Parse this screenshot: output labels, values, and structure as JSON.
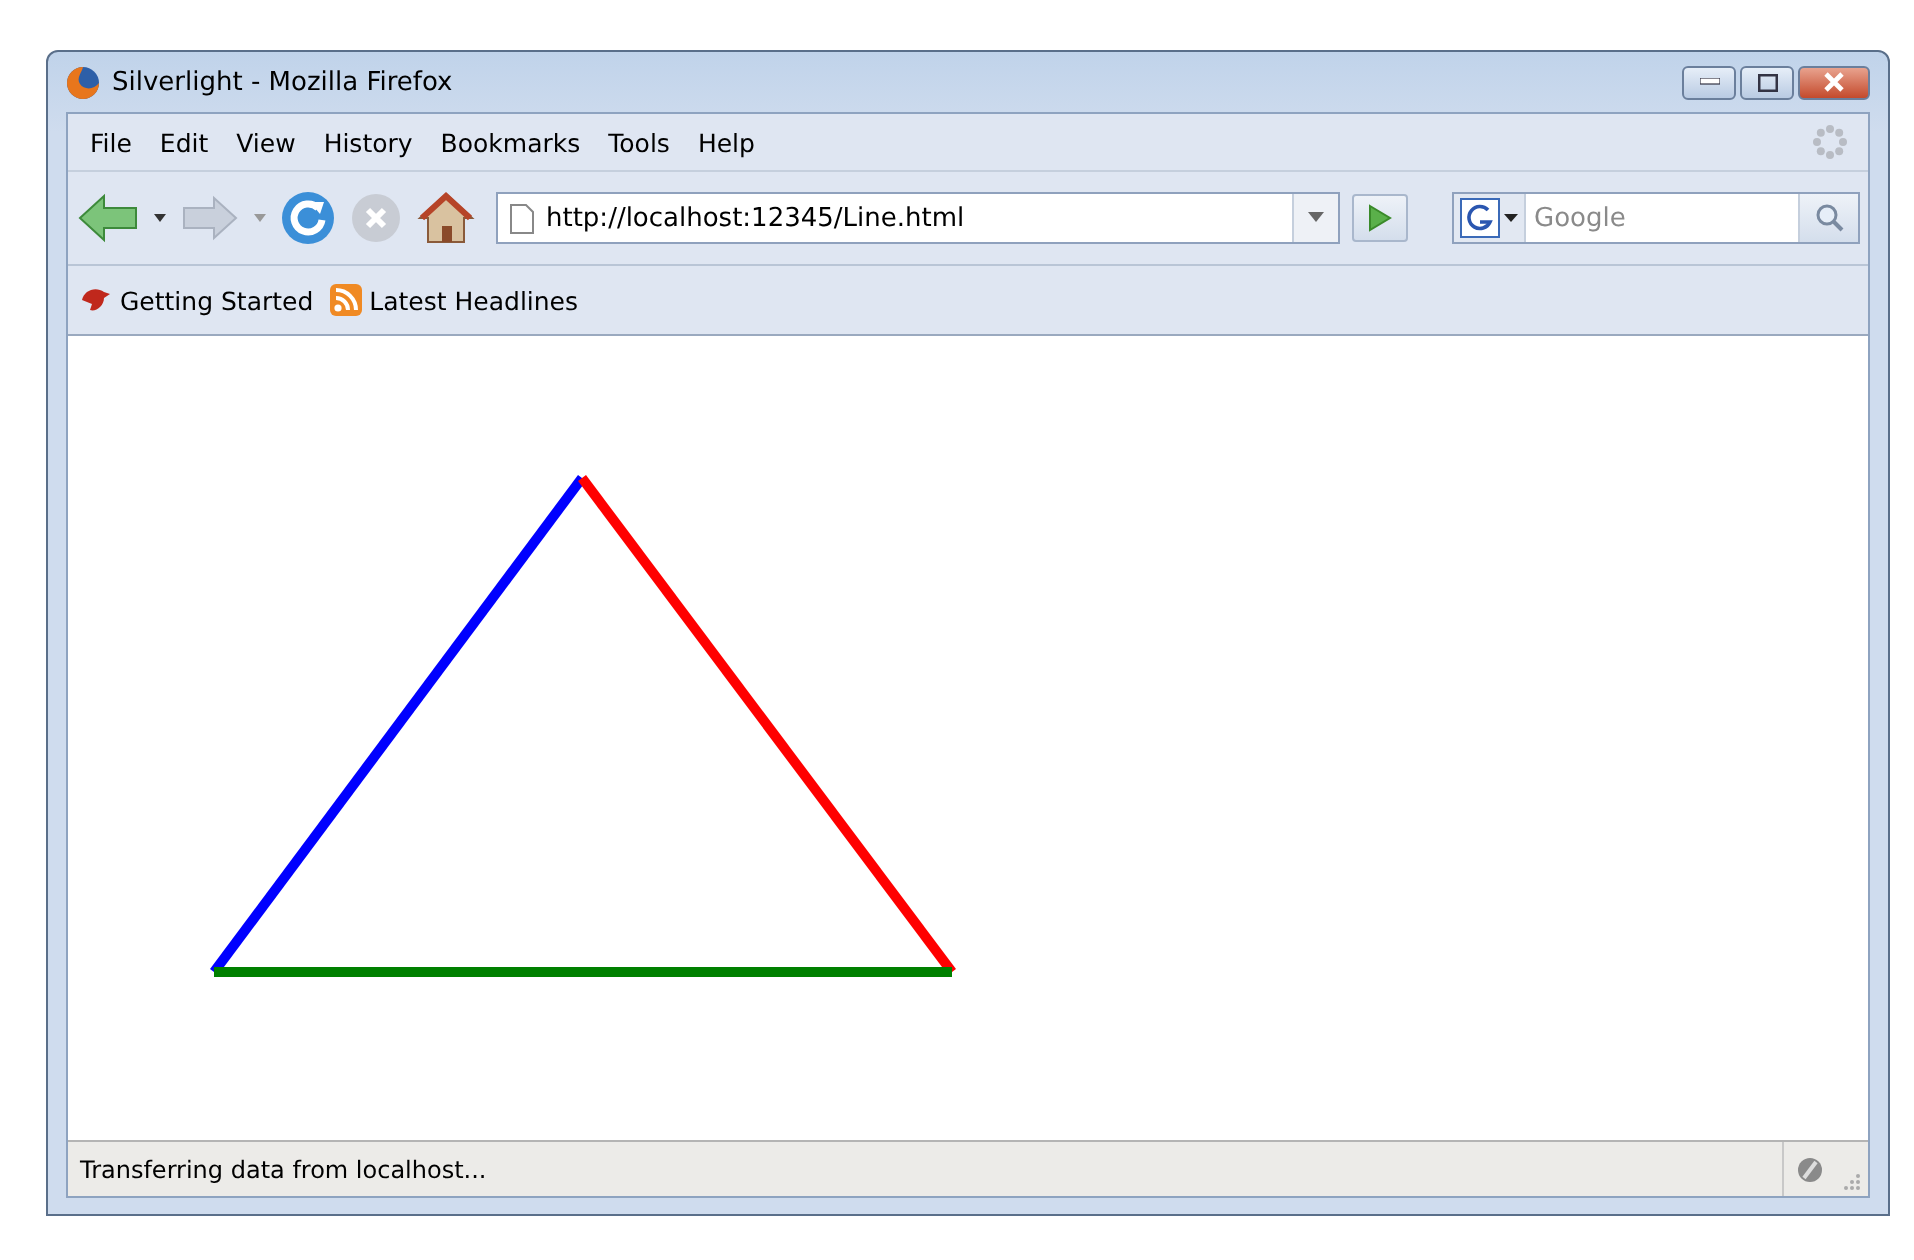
{
  "window": {
    "title": "Silverlight - Mozilla Firefox"
  },
  "menu": [
    "File",
    "Edit",
    "View",
    "History",
    "Bookmarks",
    "Tools",
    "Help"
  ],
  "navigation": {
    "address": "http://localhost:12345/Line.html",
    "search_placeholder": "Google"
  },
  "bookmarks": [
    {
      "label": "Getting Started",
      "kind": "site"
    },
    {
      "label": "Latest Headlines",
      "kind": "feed"
    }
  ],
  "content": {
    "lines": [
      {
        "color": "#0000ff"
      },
      {
        "color": "#ff0000"
      },
      {
        "color": "#008000"
      }
    ]
  },
  "status_bar": {
    "text": "Transferring data from localhost..."
  }
}
